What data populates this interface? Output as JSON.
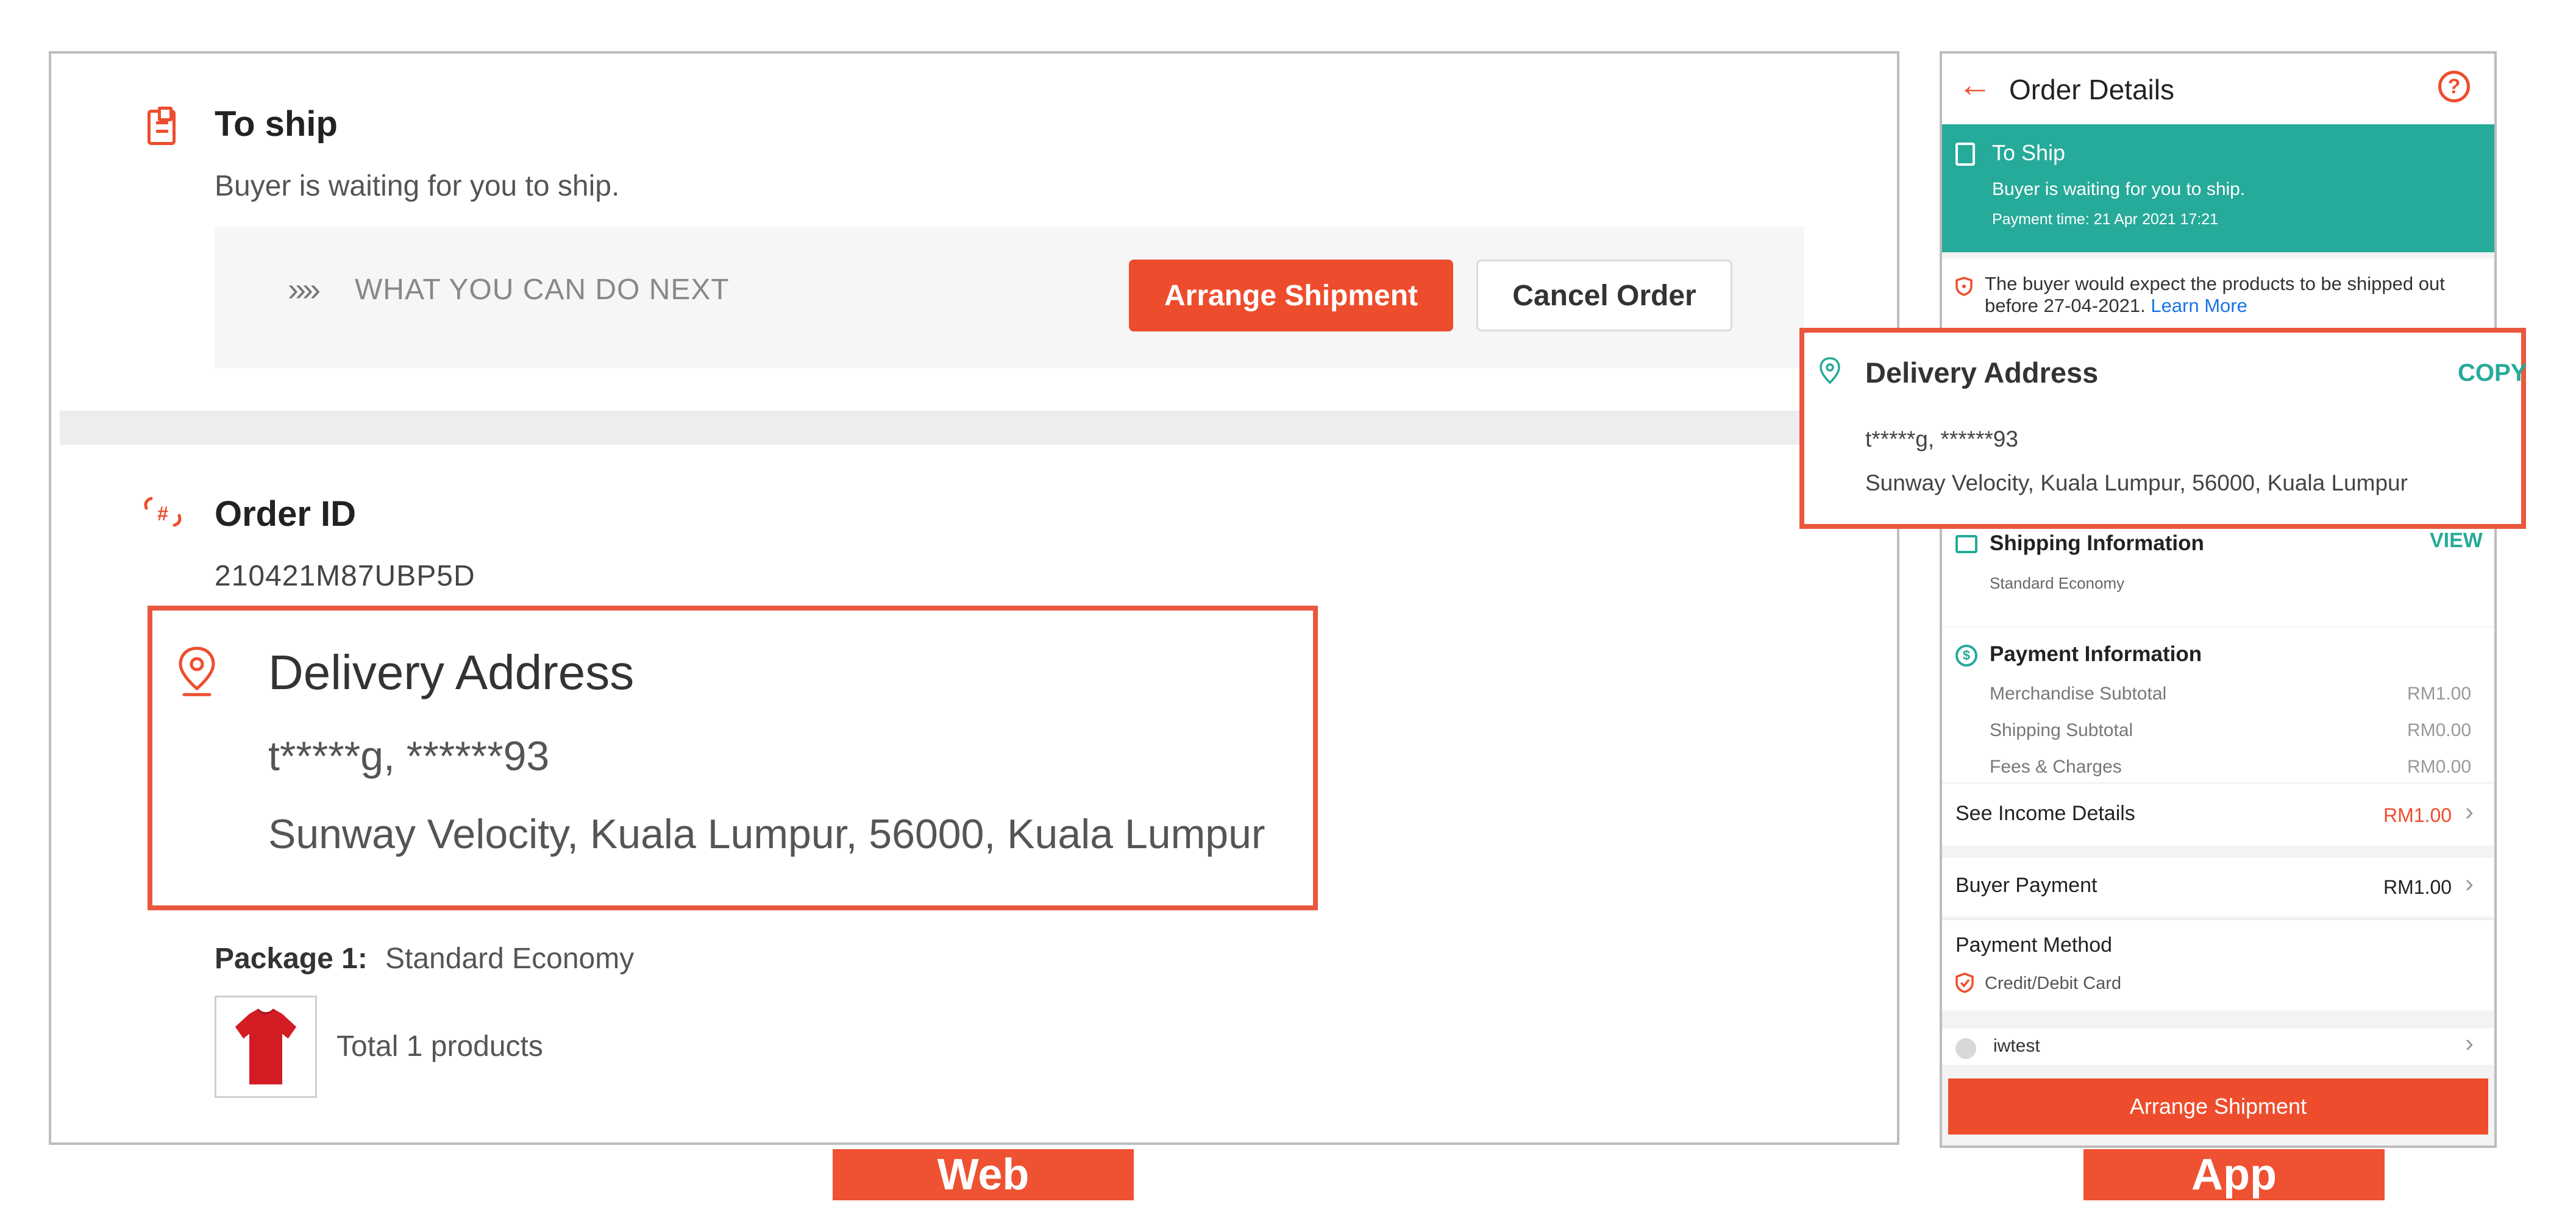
{
  "web": {
    "to_ship": {
      "title": "To ship",
      "subtitle": "Buyer is waiting for you to ship."
    },
    "next_actions": {
      "arrows": "»»",
      "label": "WHAT YOU CAN DO NEXT",
      "arrange_button": "Arrange Shipment",
      "cancel_button": "Cancel Order"
    },
    "order": {
      "title": "Order ID",
      "value": "210421M87UBP5D"
    },
    "delivery": {
      "title": "Delivery Address",
      "name_phone": "t*****g, ******93",
      "address": "Sunway Velocity, Kuala Lumpur, 56000, Kuala Lumpur"
    },
    "package": {
      "label": "Package 1:",
      "value": "Standard Economy",
      "total": "Total 1 products"
    },
    "tag": "Web"
  },
  "app": {
    "header": {
      "back": "←",
      "title": "Order Details",
      "help": "?"
    },
    "status": {
      "title": "To Ship",
      "subtitle": "Buyer is waiting for you to ship.",
      "payment_time": "Payment time: 21 Apr 2021 17:21"
    },
    "notice": {
      "text": "The buyer would expect the products to be shipped out before 27-04-2021.",
      "link": "Learn More"
    },
    "delivery": {
      "title": "Delivery Address",
      "copy": "COPY",
      "name_phone": "t*****g, ******93",
      "address": "Sunway Velocity, Kuala Lumpur, 56000, Kuala Lumpur"
    },
    "shipping": {
      "title": "Shipping Information",
      "view": "VIEW",
      "value": "Standard Economy"
    },
    "payment": {
      "title": "Payment Information",
      "icon": "$",
      "rows": [
        {
          "label": "Merchandise Subtotal",
          "value": "RM1.00"
        },
        {
          "label": "Shipping Subtotal",
          "value": "RM0.00"
        },
        {
          "label": "Fees & Charges",
          "value": "RM0.00"
        }
      ]
    },
    "income": {
      "label": "See Income Details",
      "value": "RM1.00"
    },
    "buyer_payment": {
      "label": "Buyer Payment",
      "value": "RM1.00"
    },
    "method": {
      "label": "Payment Method",
      "value": "Credit/Debit Card"
    },
    "shop": {
      "name": "iwtest"
    },
    "arrange_button": "Arrange Shipment",
    "tag": "App"
  },
  "colors": {
    "accent": "#ee4d2d",
    "teal": "#26aa99",
    "highlight_border": "#e9573d"
  },
  "icons": [
    "notes-icon",
    "hash-icon",
    "location-pin-icon",
    "back-arrow-icon",
    "help-icon",
    "shield-icon",
    "truck-icon",
    "dollar-icon",
    "chevron-right-icon",
    "card-icon",
    "tshirt-icon"
  ]
}
